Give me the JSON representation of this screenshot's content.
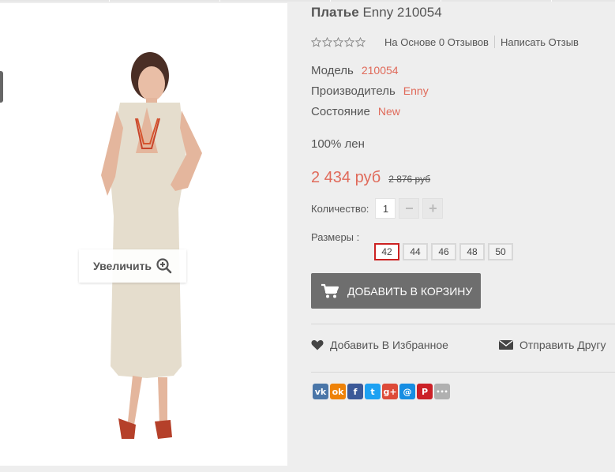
{
  "product": {
    "title_bold": "Платье",
    "title_rest": "Enny 210054",
    "rating_text": "На Основе 0 Отзывов",
    "write_review": "Написать Отзыв",
    "specs": [
      {
        "label": "Модель",
        "value": "210054"
      },
      {
        "label": "Производитель",
        "value": "Enny"
      },
      {
        "label": "Состояние",
        "value": "New"
      }
    ],
    "description": "100% лен",
    "price_new": "2 434 руб",
    "price_old": "2 876 руб",
    "quantity_label": "Количество:",
    "quantity_value": "1",
    "decrement_label": "−",
    "increment_label": "+",
    "sizes_label": "Размеры :",
    "sizes": [
      "42",
      "44",
      "46",
      "48",
      "50"
    ],
    "selected_size": "42",
    "add_to_cart": "ДОБАВИТЬ В КОРЗИНУ",
    "wishlist": "Добавить В Избранное",
    "send_friend": "Отправить Другу"
  },
  "image": {
    "zoom_label": "Увеличить"
  },
  "share": [
    {
      "icon": "vk-icon",
      "label": "vk",
      "color": "#4a76a8"
    },
    {
      "icon": "odnoklassniki-icon",
      "label": "ok",
      "color": "#ee8208"
    },
    {
      "icon": "facebook-icon",
      "label": "f",
      "color": "#3b5998"
    },
    {
      "icon": "twitter-icon",
      "label": "t",
      "color": "#1da1f2"
    },
    {
      "icon": "google-plus-icon",
      "label": "g+",
      "color": "#dd4b39"
    },
    {
      "icon": "mail-icon",
      "label": "@",
      "color": "#168de2"
    },
    {
      "icon": "pinterest-icon",
      "label": "P",
      "color": "#cb2027"
    },
    {
      "icon": "more-icon",
      "label": "•••",
      "color": "#b0b0b0"
    }
  ],
  "colors": {
    "accent": "#e06a5a",
    "button": "#6e6e6e",
    "selected_size_border": "#cc2222"
  }
}
